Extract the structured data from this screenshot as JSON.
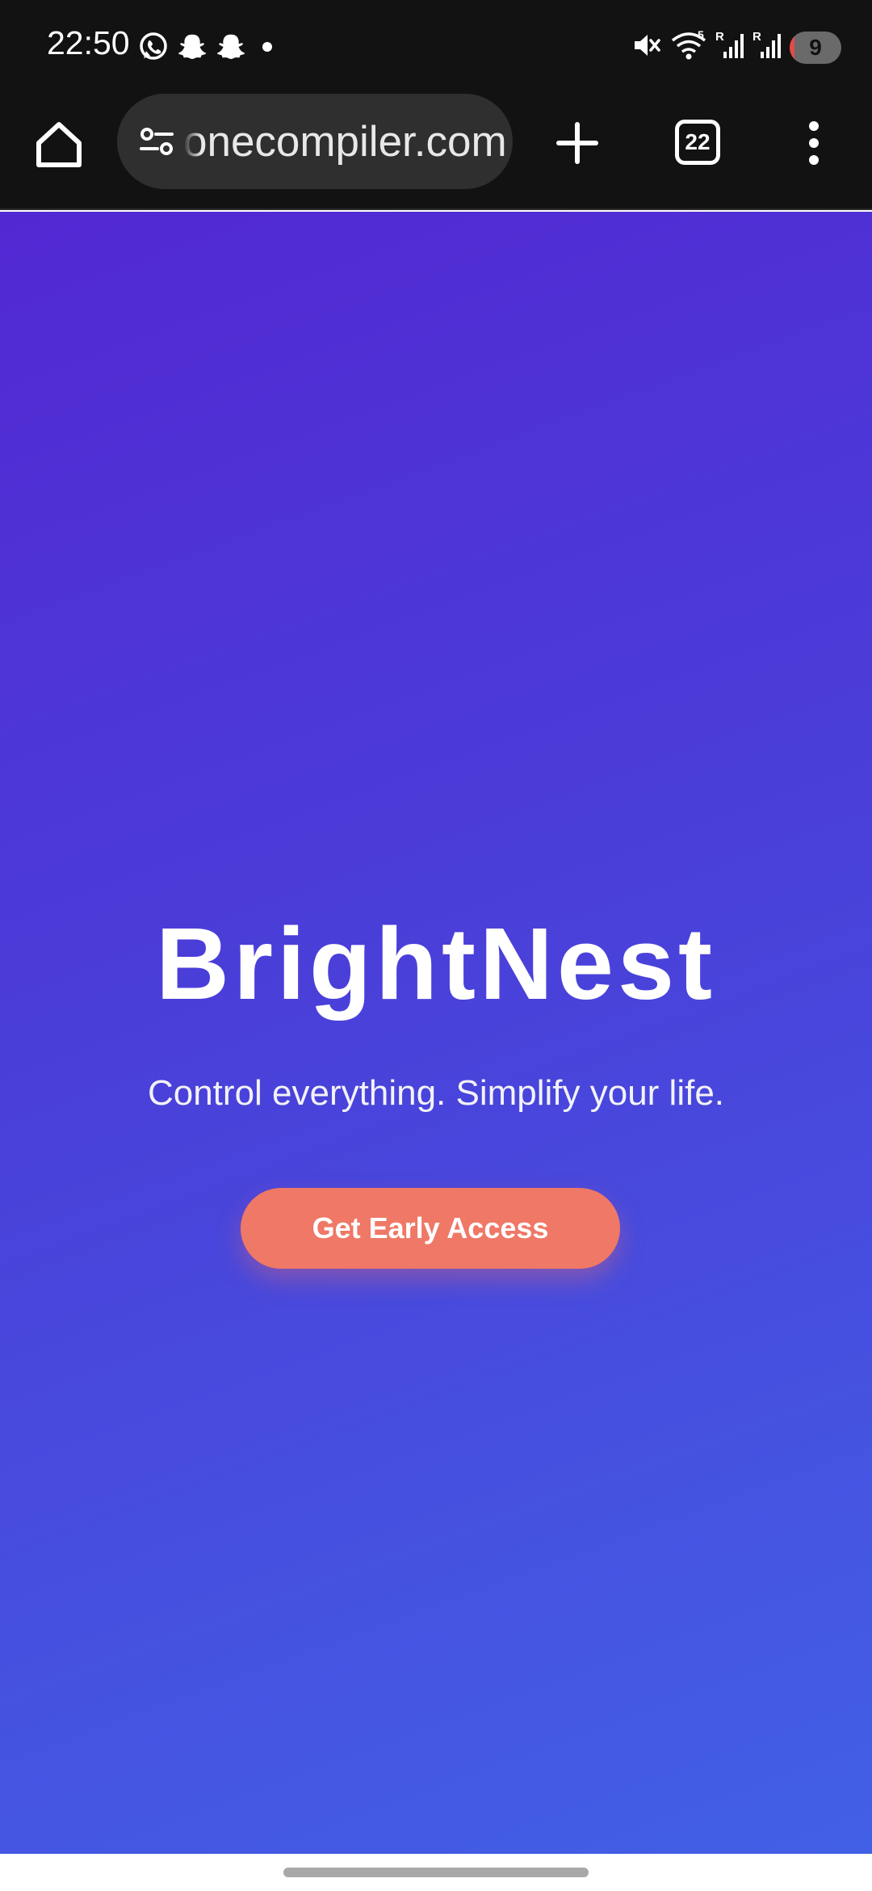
{
  "status_bar": {
    "time": "22:50",
    "left_icons": [
      "whatsapp-icon",
      "snapchat-icon",
      "snapchat-icon",
      "dot-icon"
    ],
    "right_icons": [
      "mute-icon",
      "wifi-icon",
      "signal-icon",
      "signal-icon"
    ],
    "battery_level": "9",
    "signal_labels": [
      "5",
      "R",
      "R"
    ]
  },
  "browser": {
    "url_text": "onecompiler.com",
    "tab_count": "22"
  },
  "hero": {
    "title": "BrightNest",
    "tagline": "Control everything. Simplify your life.",
    "cta_label": "Get Early Access"
  },
  "colors": {
    "toolbar_bg": "#121212",
    "hero_gradient_start": "#5228d3",
    "hero_gradient_end": "#4260e6",
    "cta_bg": "#ef7867"
  }
}
